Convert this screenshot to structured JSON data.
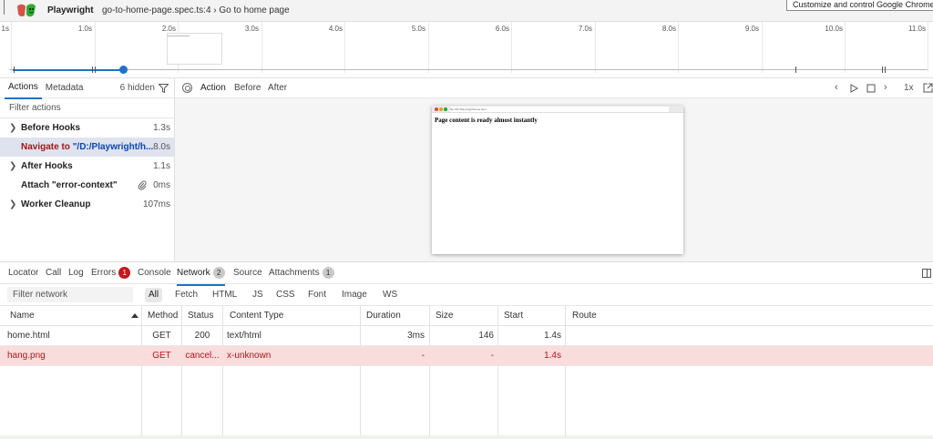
{
  "app": {
    "name": "Playwright",
    "breadcrumb": "go-to-home-page.spec.ts:4 › Go to home page",
    "tooltip": "Customize and control Google Chrome"
  },
  "timeline": {
    "ticks": [
      "1s",
      "1.0s",
      "2.0s",
      "3.0s",
      "4.0s",
      "5.0s",
      "6.0s",
      "7.0s",
      "8.0s",
      "9.0s",
      "10.0s",
      "11.0s"
    ]
  },
  "left": {
    "tabs": [
      "Actions",
      "Metadata"
    ],
    "hidden": "6 hidden",
    "filter_placeholder": "Filter actions",
    "actions": [
      {
        "label": "Before Hooks",
        "time": "1.3s"
      },
      {
        "label_kw": "Navigate to ",
        "label_url": "\"/D:/Playwright/h...",
        "time": "8.0s"
      },
      {
        "label": "After Hooks",
        "time": "1.1s"
      },
      {
        "label": "Attach \"error-context\"",
        "time": "0ms"
      },
      {
        "label": "Worker Cleanup",
        "time": "107ms"
      }
    ]
  },
  "snapshot": {
    "tabs": [
      "Action",
      "Before",
      "After"
    ],
    "speed": "1x",
    "url": "file:///D:/Playwright/home.html",
    "content": "Page content is ready almost instantly"
  },
  "bottom": {
    "tabs": [
      {
        "label": "Locator"
      },
      {
        "label": "Call"
      },
      {
        "label": "Log"
      },
      {
        "label": "Errors",
        "badge": "1"
      },
      {
        "label": "Console"
      },
      {
        "label": "Network",
        "badge": "2"
      },
      {
        "label": "Source"
      },
      {
        "label": "Attachments",
        "badge": "1"
      }
    ],
    "filter_placeholder": "Filter network",
    "types": [
      "All",
      "Fetch",
      "HTML",
      "JS",
      "CSS",
      "Font",
      "Image",
      "WS"
    ],
    "columns": [
      "Name",
      "Method",
      "Status",
      "Content Type",
      "Duration",
      "Size",
      "Start",
      "Route"
    ],
    "rows": [
      {
        "name": "home.html",
        "method": "GET",
        "status": "200",
        "type": "text/html",
        "duration": "3ms",
        "size": "146",
        "start": "1.4s",
        "route": ""
      },
      {
        "name": "hang.png",
        "method": "GET",
        "status": "cancel...",
        "type": "x-unknown",
        "duration": "-",
        "size": "-",
        "start": "1.4s",
        "route": ""
      }
    ]
  },
  "colors": {
    "accent": "#1a73c9",
    "error": "#c4161c",
    "error_row": "#f9dcdc"
  }
}
